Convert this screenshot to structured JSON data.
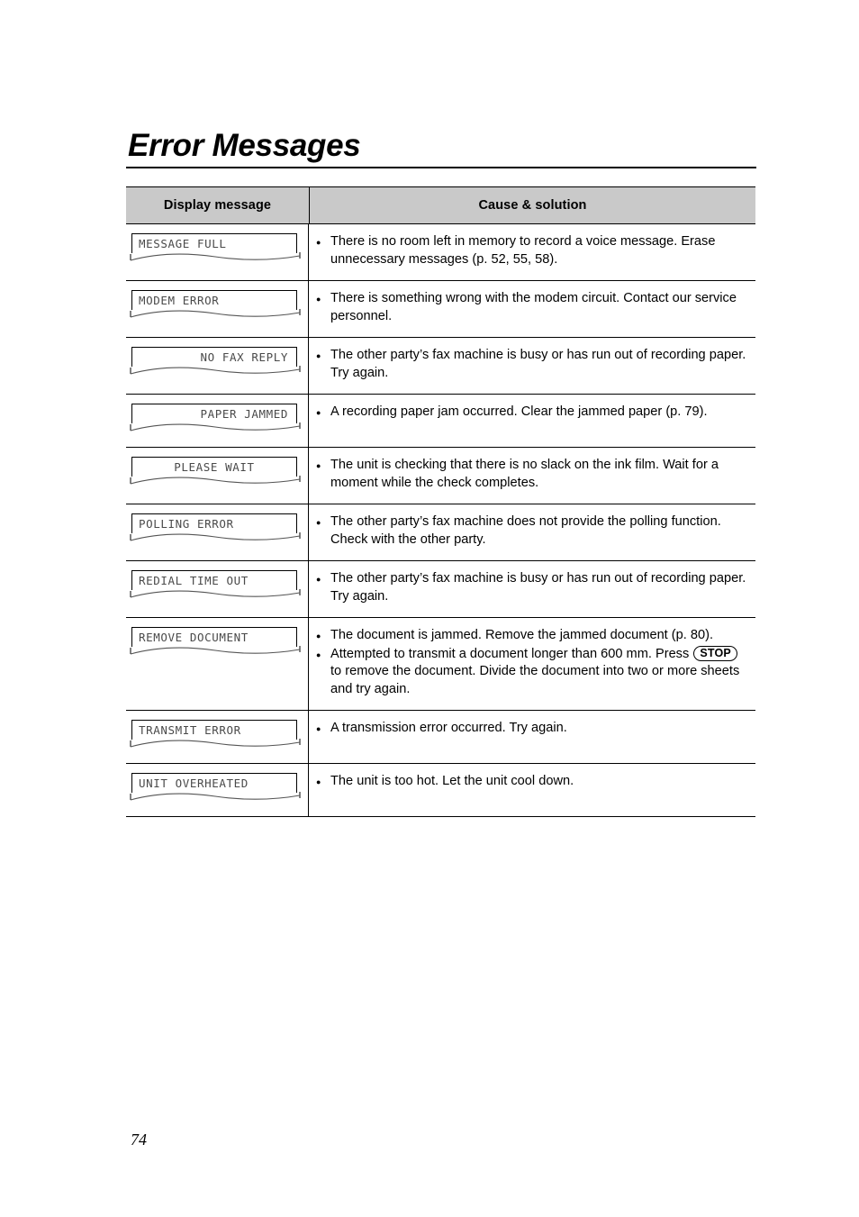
{
  "document": {
    "title": "Error Messages",
    "page_number": "74"
  },
  "table": {
    "headers": {
      "display_message": "Display message",
      "cause_solution": "Cause & solution"
    },
    "rows": [
      {
        "display": "MESSAGE FULL",
        "align": "align-left",
        "lines": [
          {
            "text": "There is no room left in memory to record a voice message. Erase unnecessary messages (p. 52, 55, 58)."
          }
        ]
      },
      {
        "display": "MODEM ERROR",
        "align": "align-left",
        "lines": [
          {
            "text": "There is something wrong with the modem circuit. Contact our service personnel."
          }
        ]
      },
      {
        "display": "NO FAX REPLY",
        "align": "align-right",
        "lines": [
          {
            "text": "The other party’s fax machine is busy or has run out of recording paper. Try again."
          }
        ]
      },
      {
        "display": "PAPER JAMMED",
        "align": "align-right",
        "lines": [
          {
            "text": "A recording paper jam occurred. Clear the jammed paper (p. 79)."
          }
        ]
      },
      {
        "display": "PLEASE WAIT",
        "align": "align-center",
        "lines": [
          {
            "text": "The unit is checking that there is no slack on the ink film. Wait for a moment while the check completes."
          }
        ]
      },
      {
        "display": "POLLING ERROR",
        "align": "align-left",
        "lines": [
          {
            "text": "The other party’s fax machine does not provide the polling function. Check with the other party."
          }
        ]
      },
      {
        "display": "REDIAL TIME OUT",
        "align": "align-left",
        "lines": [
          {
            "text": "The other party’s fax machine is busy or has run out of recording paper. Try again."
          }
        ]
      },
      {
        "display": "REMOVE DOCUMENT",
        "align": "align-left",
        "lines": [
          {
            "text": "The document is jammed. Remove the jammed document (p. 80)."
          },
          {
            "pre": "Attempted to transmit a document longer than 600 mm. Press ",
            "key": "STOP",
            "post": " to remove the document. Divide the document into two or more sheets and try again."
          }
        ]
      },
      {
        "display": "TRANSMIT ERROR",
        "align": "align-left",
        "lines": [
          {
            "text": "A transmission error occurred. Try again."
          }
        ]
      },
      {
        "display": "UNIT OVERHEATED",
        "align": "align-left",
        "lines": [
          {
            "text": "The unit is too hot. Let the unit cool down."
          }
        ]
      }
    ]
  },
  "colors": {
    "header_fill": "#c9c9c9",
    "rule": "#000000",
    "lcd_text": "#4a4a4a"
  }
}
